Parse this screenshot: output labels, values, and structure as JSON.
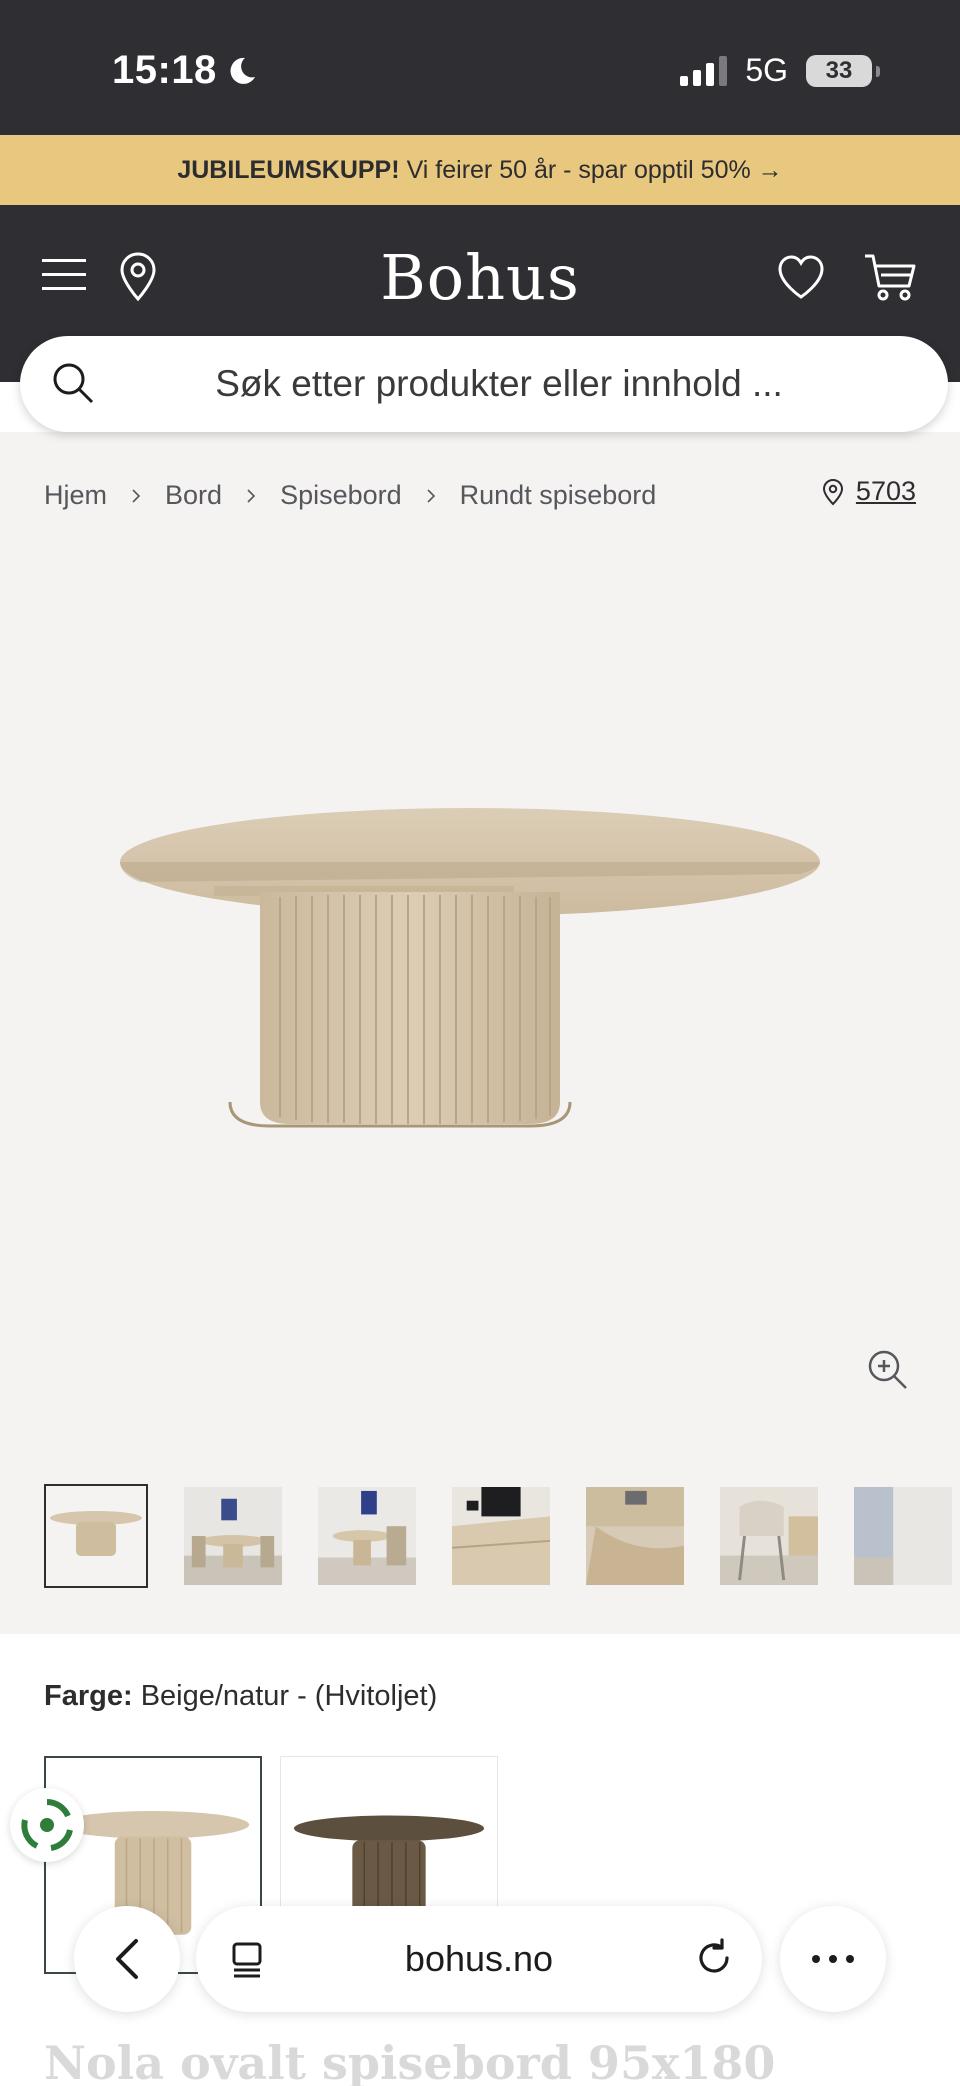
{
  "status_bar": {
    "time": "15:18",
    "network": "5G",
    "battery": "33"
  },
  "promo": {
    "bold": "JUBILEUMSKUPP!",
    "text": "Vi feirer 50 år - spar opptil 50% →"
  },
  "header": {
    "logo": "Bohus"
  },
  "search": {
    "placeholder": "Søk etter produkter eller innhold ..."
  },
  "breadcrumb": [
    "Hjem",
    "Bord",
    "Spisebord",
    "Rundt spisebord"
  ],
  "store": {
    "number": "5703"
  },
  "thumbnails": [
    "table-product",
    "dining-room",
    "dining-room-art",
    "extending-leaf",
    "table-closeup",
    "chair-closeup",
    "room-partial"
  ],
  "color": {
    "label": "Farge:",
    "value": "Beige/natur - (Hvitoljet)"
  },
  "swatches": [
    "Beige/natur - (Hvitoljet)",
    "dark-oak"
  ],
  "product": {
    "title": "Nola ovalt spisebord 95x180"
  },
  "browser": {
    "url": "bohus.no"
  },
  "colors": {
    "header_bg": "#2f2f33",
    "promo_bg": "#e8c77f",
    "gallery_bg": "#f4f3f2",
    "wood": "#d9c8b0"
  }
}
